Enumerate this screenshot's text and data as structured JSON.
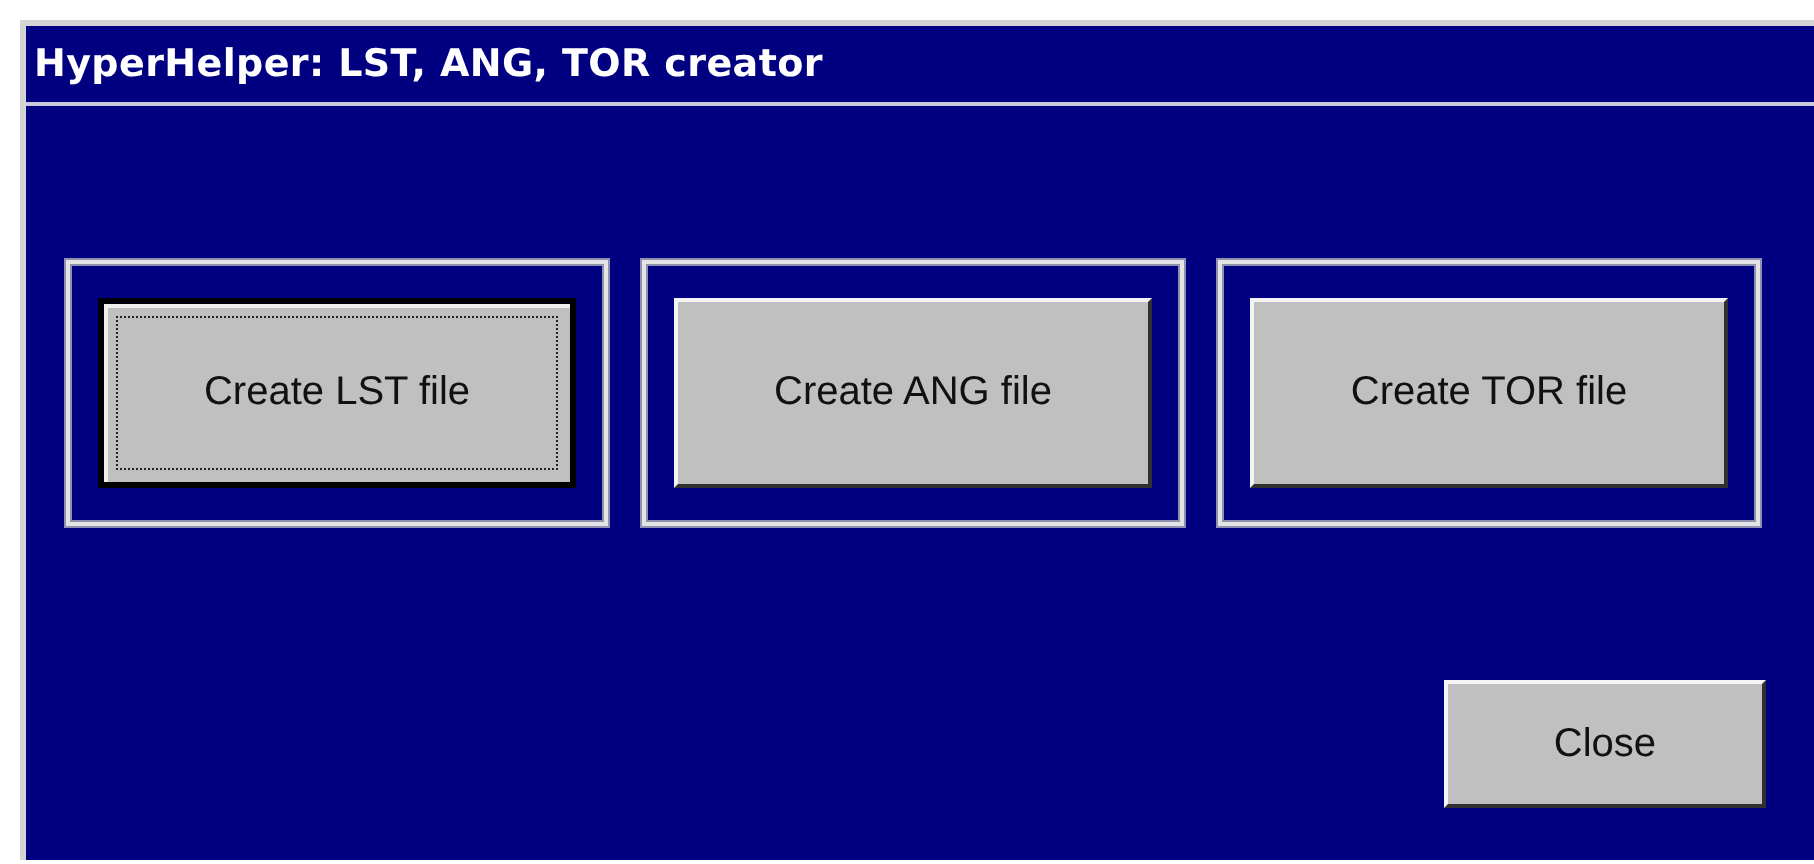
{
  "window": {
    "title": "HyperHelper: LST, ANG, TOR creator"
  },
  "groups": [
    {
      "button": {
        "label": "Create LST file",
        "focused": true
      }
    },
    {
      "button": {
        "label": "Create ANG file",
        "focused": false
      }
    },
    {
      "button": {
        "label": "Create TOR file",
        "focused": false
      }
    }
  ],
  "close_button": {
    "label": "Close",
    "focused": false
  }
}
